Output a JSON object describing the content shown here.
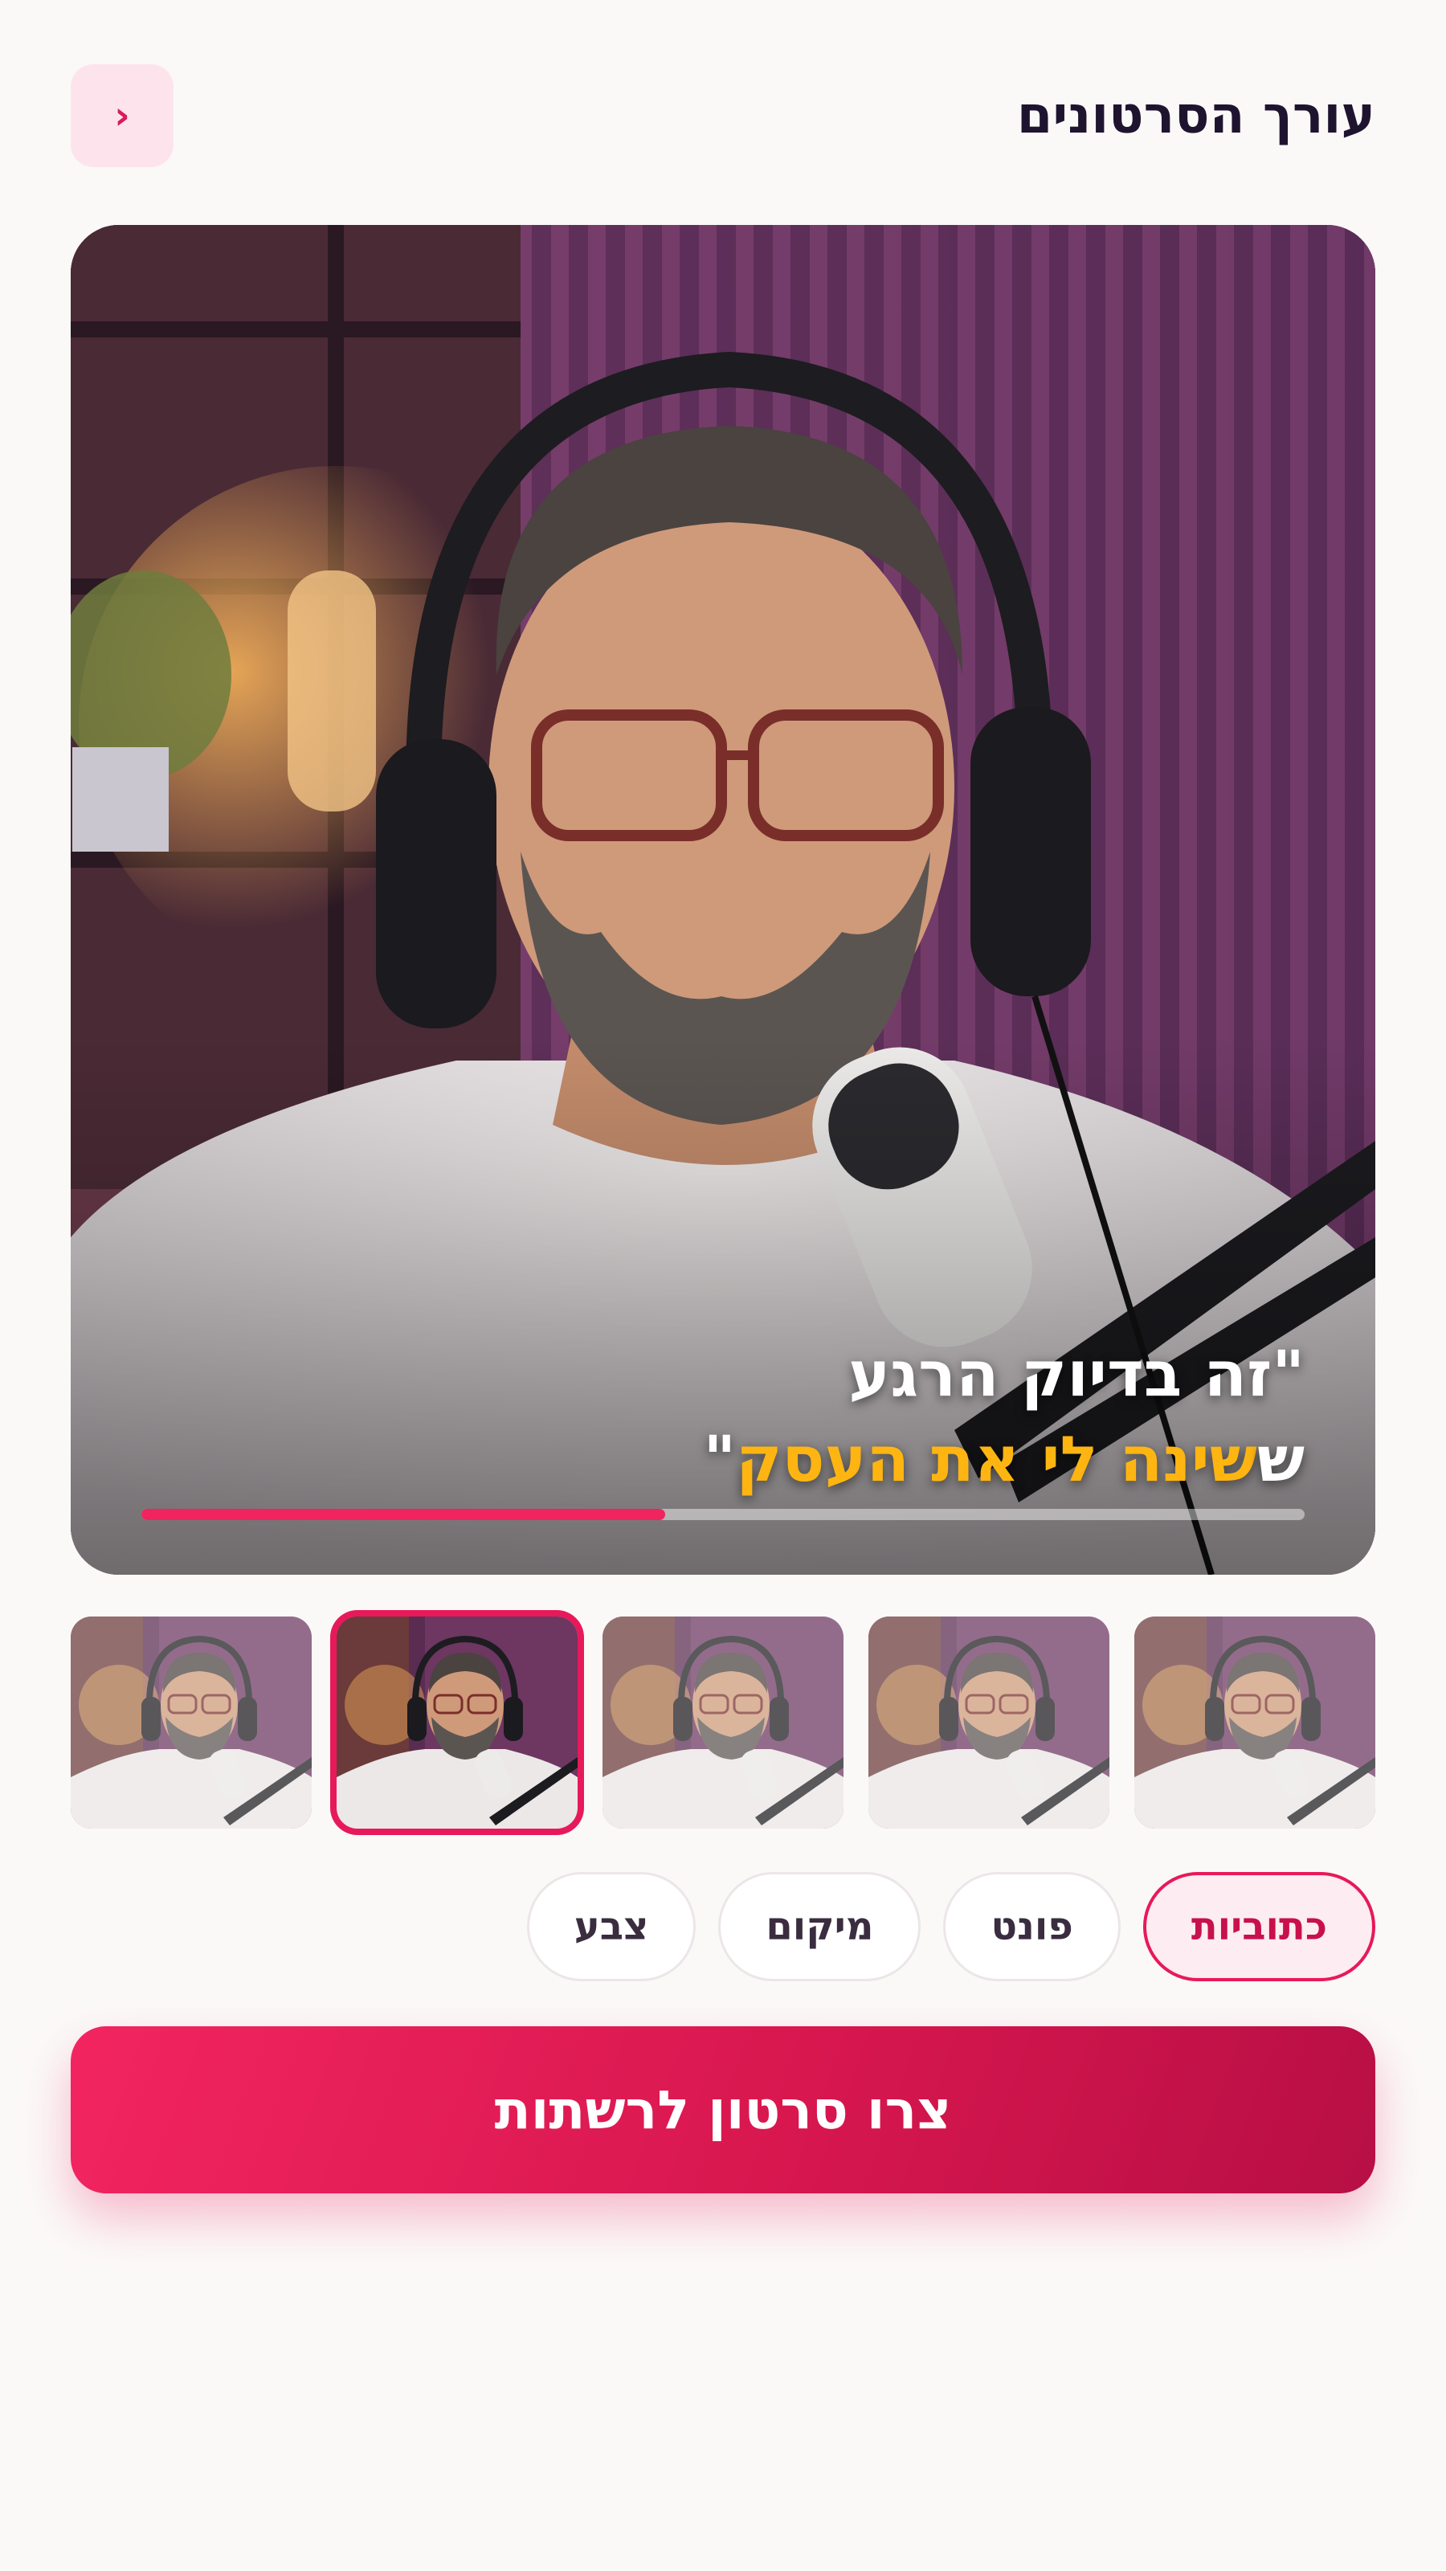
{
  "header": {
    "title": "עורך הסרטונים",
    "back_label": "‹"
  },
  "preview": {
    "caption_line1": "\"זה בדיוק הרגע",
    "caption_line2_part1": "ש",
    "caption_line2_part2": "שינה לי את העסק",
    "caption_line2_part3": "\"",
    "progress_fraction": 0.45
  },
  "thumbnails": {
    "count": 5,
    "active_index": 1
  },
  "tabs": [
    {
      "label": "כתוביות",
      "active": true
    },
    {
      "label": "פונט",
      "active": false
    },
    {
      "label": "מיקום",
      "active": false
    },
    {
      "label": "צבע",
      "active": false
    }
  ],
  "cta": {
    "label": "צרו סרטון לרשתות"
  },
  "colors": {
    "accent": "#e8195a",
    "caption_highlight": "#ffb511",
    "background": "#fbf9f8"
  }
}
